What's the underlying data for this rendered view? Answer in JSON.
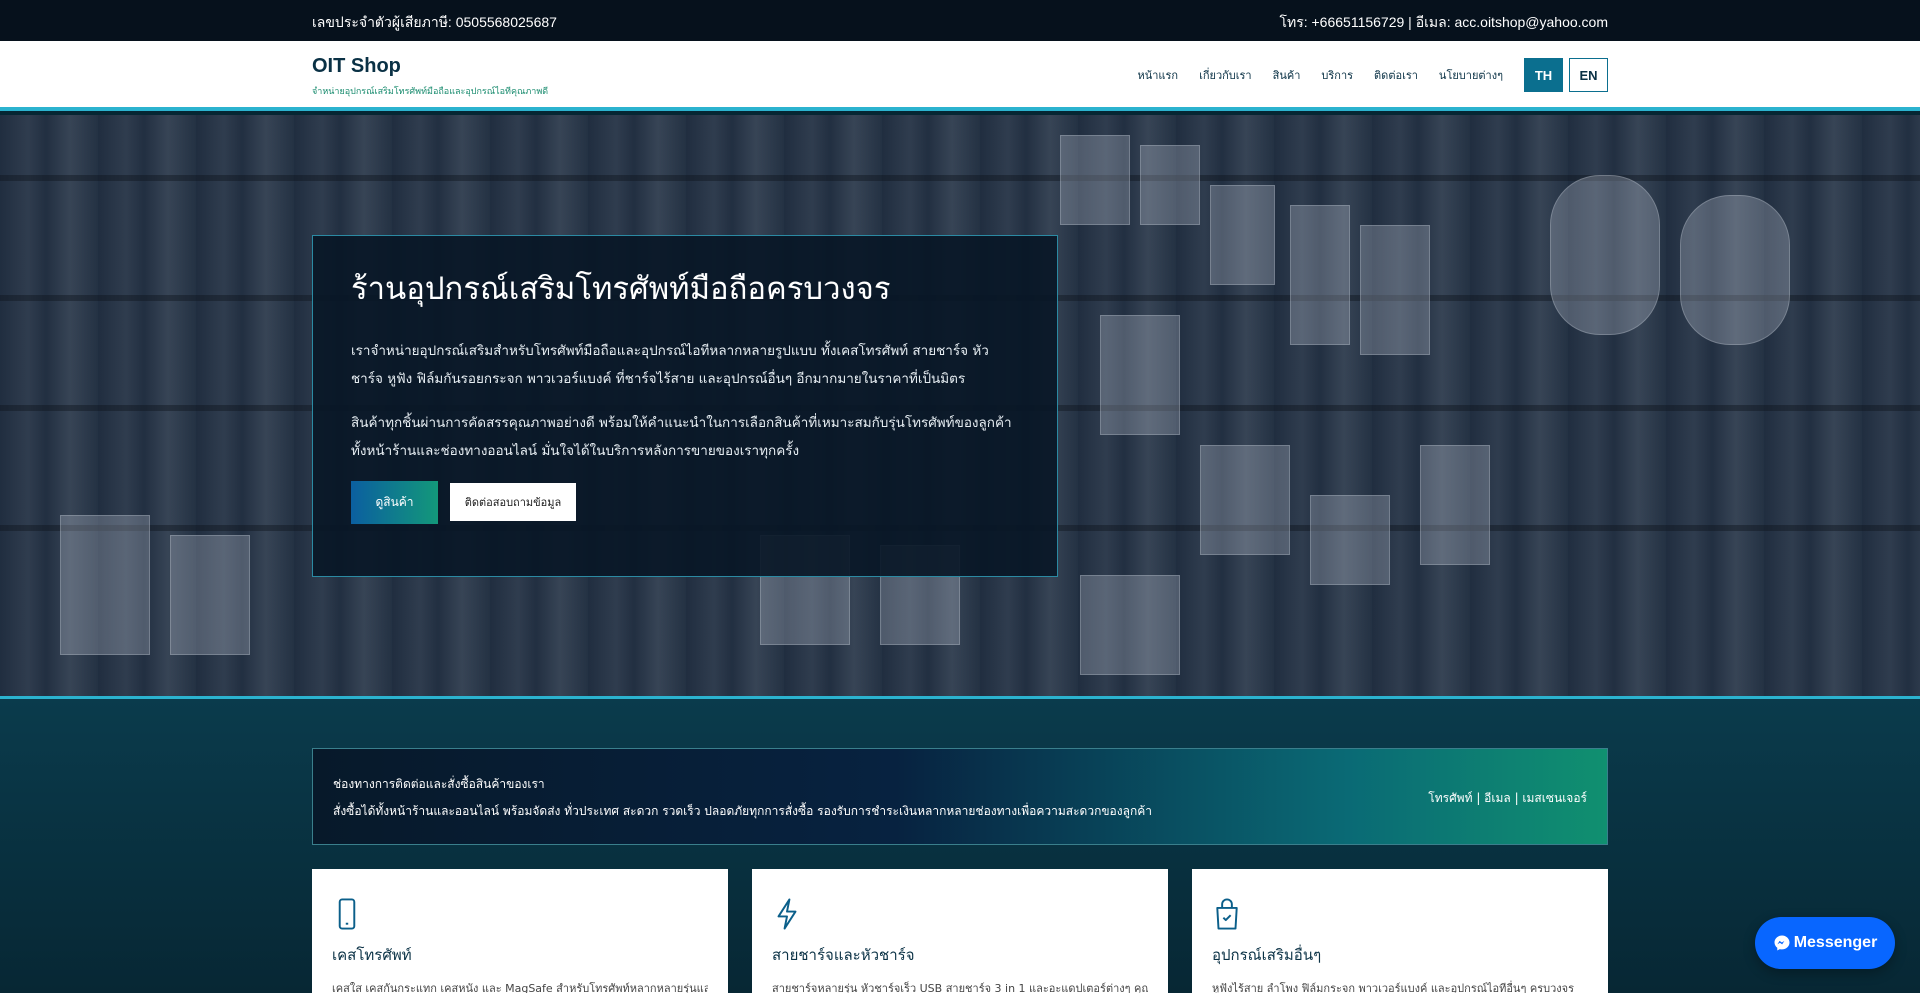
{
  "topbar": {
    "left_text": "เลขประจำตัวผู้เสียภาษี: 0505568025687",
    "right_text": "โทร: +66651156729 | อีเมล: acc.oitshop@yahoo.com"
  },
  "header": {
    "brand": "OIT Shop",
    "tagline": "จำหน่ายอุปกรณ์เสริมโทรศัพท์มือถือและอุปกรณ์ไอทีคุณภาพดี",
    "nav": [
      "หน้าแรก",
      "เกี่ยวกับเรา",
      "สินค้า",
      "บริการ",
      "ติดต่อเรา",
      "นโยบายต่างๆ"
    ],
    "lang_th": "TH",
    "lang_en": "EN"
  },
  "hero": {
    "title": "ร้านอุปกรณ์เสริมโทรศัพท์มือถือครบวงจร",
    "p1": "เราจำหน่ายอุปกรณ์เสริมสำหรับโทรศัพท์มือถือและอุปกรณ์ไอทีหลากหลายรูปแบบ ทั้งเคสโทรศัพท์ สายชาร์จ หัวชาร์จ หูฟัง ฟิล์มกันรอยกระจก พาวเวอร์แบงค์ ที่ชาร์จไร้สาย และอุปกรณ์อื่นๆ อีกมากมายในราคาที่เป็นมิตร",
    "p2": "สินค้าทุกชิ้นผ่านการคัดสรรคุณภาพอย่างดี พร้อมให้คำแนะนำในการเลือกสินค้าที่เหมาะสมกับรุ่นโทรศัพท์ของลูกค้า ทั้งหน้าร้านและช่องทางออนไลน์ มั่นใจได้ในบริการหลังการขายของเราทุกครั้ง",
    "btn_primary": "ดูสินค้า",
    "btn_secondary": "ติดต่อสอบถามข้อมูล"
  },
  "promo": {
    "line1": "ช่องทางการติดต่อและสั่งซื้อสินค้าของเรา",
    "line2": "สั่งซื้อได้ทั้งหน้าร้านและออนไลน์ พร้อมจัดส่ง ทั่วประเทศ สะดวก รวดเร็ว ปลอดภัยทุกการสั่งซื้อ รองรับการชำระเงินหลากหลายช่องทางเพื่อความสะดวกของลูกค้า",
    "right": "โทรศัพท์ | อีเมล | เมสเซนเจอร์"
  },
  "cards": [
    {
      "icon": "smartphone-icon",
      "title": "เคสโทรศัพท์",
      "desc": "เคสใส เคสกันกระแทก เคสหนัง และ MagSafe สำหรับโทรศัพท์หลากหลายรุ่นและยี่ห้อ"
    },
    {
      "icon": "lightning-icon",
      "title": "สายชาร์จและหัวชาร์จ",
      "desc": "สายชาร์จหลายรุ่น หัวชาร์จเร็ว USB สายชาร์จ 3 in 1 และอะแดปเตอร์ต่างๆ คุณภาพ"
    },
    {
      "icon": "shopping-bag-icon",
      "title": "อุปกรณ์เสริมอื่นๆ",
      "desc": "หูฟังไร้สาย ลำโพง ฟิล์มกระจก พาวเวอร์แบงค์ และอุปกรณ์ไอทีอื่นๆ ครบวงจร"
    }
  ],
  "messenger": {
    "label": "Messenger"
  }
}
